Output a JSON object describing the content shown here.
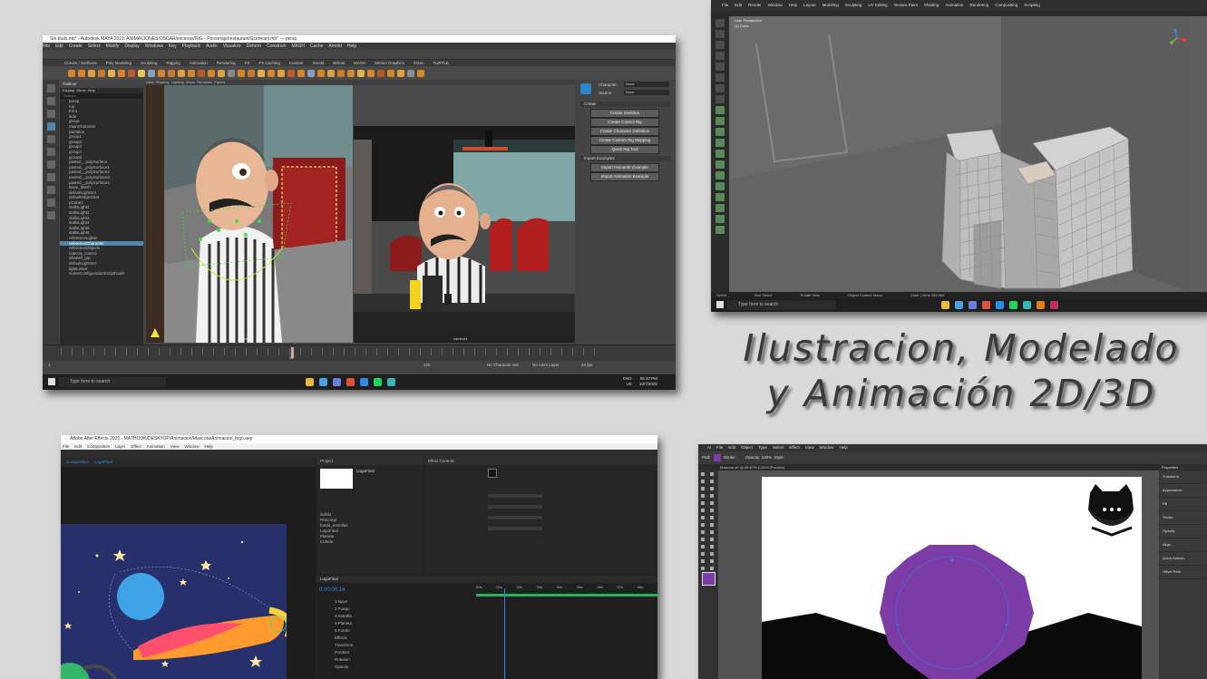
{
  "headline": {
    "line1": "Ilustracion, Modelado",
    "line2": "y Animación 2D/3D"
  },
  "maya": {
    "title": "Sin título.mb* - Autodesk MAYA 2019: ANIMACIONES/OSCAR/escenas/RIG - Personaje/restaurant/Sceneary.mb* --- persp",
    "menus": [
      "File",
      "Edit",
      "Create",
      "Select",
      "Modify",
      "Display",
      "Windows",
      "Key",
      "Playback",
      "Audio",
      "Visualize",
      "Deform",
      "Constrain",
      "MASH",
      "Cache",
      "Arnold",
      "Help"
    ],
    "shelf_tabs": [
      "Curves / Surfaces",
      "Poly Modeling",
      "Sculpting",
      "Rigging",
      "Animation",
      "Rendering",
      "FX",
      "FX Caching",
      "Custom",
      "Arnold",
      "Bifrost",
      "MASH",
      "Motion Graphics",
      "XGen",
      "TURTLE"
    ],
    "outliner_header": "Outliner",
    "outliner_menu": [
      "Display",
      "Show",
      "Help"
    ],
    "outliner_search": "Search...",
    "outliner_items": [
      "persp",
      "top",
      "front",
      "side",
      "group",
      "MainCharacter",
      "pantalon",
      "group1",
      "group2",
      "group3",
      "group4",
      "group5",
      "pasted__polySurface",
      "pasted__polySurface1",
      "pasted__polySurface2",
      "pasted__polySurface3",
      "pasted__polySurface4",
      "Base_Mesh",
      "defaultLightSet",
      "defaultObjectSet",
      "pCube1",
      "stallsLight1",
      "stallsLight2",
      "stallsLight3",
      "stallsLight4",
      "stallsLight5",
      "stallsLight6",
      "referenceLights",
      "referenceCharacter",
      "referenceObjects",
      "cabeza_control",
      "sillaRef_grp",
      "defaultLightSet",
      "lightLinker",
      "sceneConfigurationScriptNode"
    ],
    "outliner_selected": "referenceCharacter",
    "panel_menus": [
      "View",
      "Shading",
      "Lighting",
      "Show",
      "Renderer",
      "Panels"
    ],
    "viewport_left_label": "persp",
    "viewport_right_label": "camera1",
    "hik_character_label": "Character:",
    "hik_source_label": "Source:",
    "hik_character_value": "None",
    "hik_source_value": "None",
    "hik_create_title": "Create",
    "hik_create_buttons": [
      "Create Skeleton",
      "Create Control Rig",
      "Create Character Definition",
      "Create Custom Rig Mapping",
      "Quick Rig Tool"
    ],
    "hik_import_title": "Import Examples",
    "hik_import_buttons": [
      "Import HumanIK Example",
      "Import Animation Example"
    ],
    "timeline_start": "1",
    "timeline_end": "120",
    "current_frame": "24",
    "fps": "24 fps",
    "no_character": "No Character Set",
    "no_anim_layer": "No Anim Layer",
    "search": "Type here to search",
    "clock_time": "05:37 PM",
    "clock_date": "10/7/2020",
    "lang": "ENG",
    "lang2": "US"
  },
  "blender": {
    "menus": [
      "File",
      "Edit",
      "Render",
      "Window",
      "Help",
      "Layout",
      "Modeling",
      "Sculpting",
      "UV Editing",
      "Texture Paint",
      "Shading",
      "Animation",
      "Rendering",
      "Compositing",
      "Scripting"
    ],
    "mode": "Edit Mode",
    "view_label": "User Perspective",
    "object_label": "(1) Cube",
    "orientation": "Global",
    "status": [
      "Select",
      "Box Select",
      "Rotate View",
      "Object Context Menu",
      "Cube | Verts 352/384"
    ],
    "search": "Type here to search"
  },
  "ae": {
    "title": "Adobe After Effects 2020 - MATHOOK/DESKTOP/Animacion/Mascota/Animacion_logo.aep",
    "menus": [
      "File",
      "Edit",
      "Composition",
      "Layer",
      "Effect",
      "Animation",
      "View",
      "Window",
      "Help"
    ],
    "comp_tab": "Composition",
    "comp_name": "LogoFinal",
    "project_label": "Project",
    "effects_label": "Effect Controls",
    "project_items": [
      "Solids",
      "Precomp",
      "fondo_estrellas",
      "LogoFinal",
      "Planeta",
      "Cohete"
    ],
    "timecode": "0;00;00;14",
    "layers": [
      "1  Nave",
      "2  Fuego",
      "3  Estrella",
      "4  Planeta",
      "5  Fondo",
      "Effects",
      "Transform",
      "Position",
      "Rotation",
      "Opacity"
    ],
    "ruler": [
      "00s",
      "01s",
      "02s",
      "03s",
      "04s",
      "05s",
      "06s",
      "07s",
      "08s"
    ]
  },
  "ai": {
    "menus": [
      "Ai",
      "File",
      "Edit",
      "Object",
      "Type",
      "Select",
      "Effect",
      "View",
      "Window",
      "Help"
    ],
    "control_label": "Path",
    "stroke_label": "Stroke:",
    "opacity_label": "Opacity:",
    "opacity_value": "100%",
    "style_label": "Style:",
    "doc_tab": "Mascota.ai* @ 66.67% (CMYK/Preview)",
    "panel_tabs": [
      "Properties",
      "Layers"
    ],
    "panel_items": [
      "Transform",
      "Appearance",
      "Fill",
      "Stroke",
      "Opacity",
      "Align",
      "Quick Actions",
      "Offset Path"
    ]
  },
  "colors": {
    "accent_blue": "#2d8ceb",
    "mascot_purple": "#7b3ca6",
    "ae_canvas": "#27306b",
    "maya_highlight": "#5285a6"
  }
}
